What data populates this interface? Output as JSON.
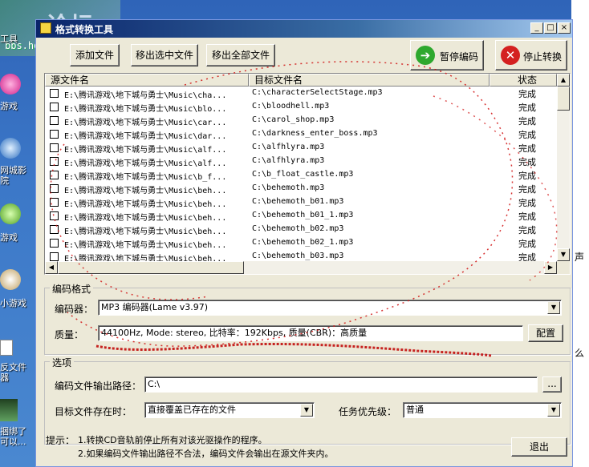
{
  "desktop": {
    "left_labels": [
      "工具",
      "游戏",
      "网城影\n院",
      "游戏",
      "小游戏",
      "反文件\n器",
      "捆绑了\n可以..."
    ],
    "right_labels": [
      "声",
      "么"
    ],
    "watermark": "bbs.houdao.com"
  },
  "window": {
    "title": "格式转换工具",
    "controls": {
      "min": "_",
      "max": "□",
      "close": "×"
    }
  },
  "toolbar": {
    "add_file": "添加文件",
    "remove_selected": "移出选中文件",
    "remove_all": "移出全部文件",
    "pause_encode": "暂停编码",
    "stop_convert": "停止转换"
  },
  "table": {
    "columns": {
      "source": "源文件名",
      "target": "目标文件名",
      "status": "状态"
    },
    "rows": [
      {
        "source": "E:\\腾讯游戏\\地下城与勇士\\Music\\cha...",
        "target": "C:\\characterSelectStage.mp3",
        "status": "完成"
      },
      {
        "source": "E:\\腾讯游戏\\地下城与勇士\\Music\\blo...",
        "target": "C:\\bloodhell.mp3",
        "status": "完成"
      },
      {
        "source": "E:\\腾讯游戏\\地下城与勇士\\Music\\car...",
        "target": "C:\\carol_shop.mp3",
        "status": "完成"
      },
      {
        "source": "E:\\腾讯游戏\\地下城与勇士\\Music\\dar...",
        "target": "C:\\darkness_enter_boss.mp3",
        "status": "完成"
      },
      {
        "source": "E:\\腾讯游戏\\地下城与勇士\\Music\\alf...",
        "target": "C:\\alfhlyra.mp3",
        "status": "完成"
      },
      {
        "source": "E:\\腾讯游戏\\地下城与勇士\\Music\\alf...",
        "target": "C:\\alfhlyra.mp3",
        "status": "完成"
      },
      {
        "source": "E:\\腾讯游戏\\地下城与勇士\\Music\\b_f...",
        "target": "C:\\b_float_castle.mp3",
        "status": "完成"
      },
      {
        "source": "E:\\腾讯游戏\\地下城与勇士\\Music\\beh...",
        "target": "C:\\behemoth.mp3",
        "status": "完成"
      },
      {
        "source": "E:\\腾讯游戏\\地下城与勇士\\Music\\beh...",
        "target": "C:\\behemoth_b01.mp3",
        "status": "完成"
      },
      {
        "source": "E:\\腾讯游戏\\地下城与勇士\\Music\\beh...",
        "target": "C:\\behemoth_b01_1.mp3",
        "status": "完成"
      },
      {
        "source": "E:\\腾讯游戏\\地下城与勇士\\Music\\beh...",
        "target": "C:\\behemoth_b02.mp3",
        "status": "完成"
      },
      {
        "source": "E:\\腾讯游戏\\地下城与勇士\\Music\\beh...",
        "target": "C:\\behemoth_b02_1.mp3",
        "status": "完成"
      },
      {
        "source": "E:\\腾讯游戏\\地下城与勇士\\Music\\beh...",
        "target": "C:\\behemoth_b03.mp3",
        "status": "完成"
      }
    ]
  },
  "encoding": {
    "group_title": "编码格式",
    "encoder_label": "编码器：",
    "encoder_value": "MP3 编码器(Lame v3.97)",
    "quality_label": "质量：",
    "quality_value": "44100Hz, Mode: stereo, 比特率：192Kbps, 质量(CBR)：高质量",
    "config_button": "配置"
  },
  "options": {
    "group_title": "选项",
    "output_path_label": "编码文件输出路径：",
    "output_path_value": "C:\\",
    "browse_button": "...",
    "exists_label": "目标文件存在时：",
    "exists_value": "直接覆盖已存在的文件",
    "priority_label": "任务优先级：",
    "priority_value": "普通"
  },
  "footer": {
    "hint_label": "提示：",
    "hint_1": "1.转换CD音轨前停止所有对该光驱操作的程序。",
    "hint_2": "2.如果编码文件输出路径不合法，编码文件会输出在源文件夹内。",
    "exit_button": "退出"
  }
}
